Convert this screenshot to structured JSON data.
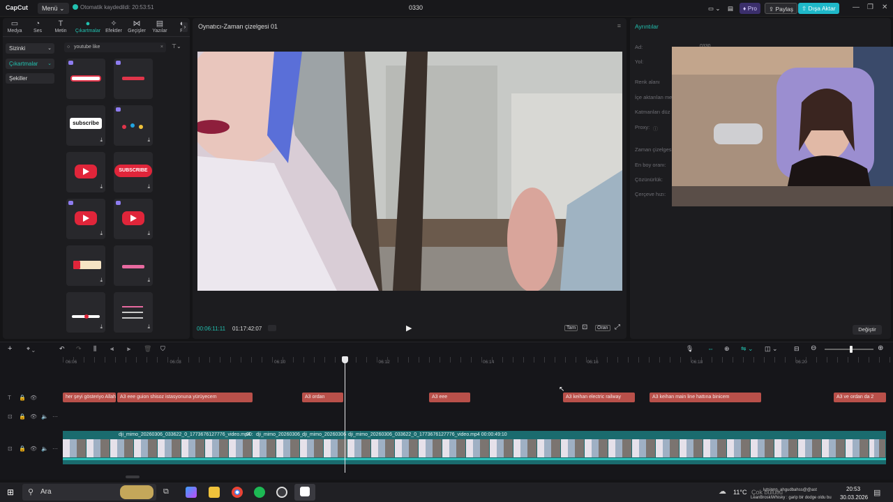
{
  "app": {
    "logo": "CapCut",
    "menu_label": "Menü",
    "autosave": "Otomatik kaydedildi: 20:53:51",
    "project_title": "0330",
    "pro_label": "Pro",
    "share_label": "Paylaş",
    "export_label": "Dışa Aktar"
  },
  "tool_tabs": [
    {
      "label": "Medya",
      "icon": "media-icon"
    },
    {
      "label": "Ses",
      "icon": "audio-icon"
    },
    {
      "label": "Metin",
      "icon": "text-icon"
    },
    {
      "label": "Çıkartmalar",
      "icon": "sticker-icon",
      "active": true
    },
    {
      "label": "Efektler",
      "icon": "effects-icon"
    },
    {
      "label": "Geçişler",
      "icon": "transitions-icon"
    },
    {
      "label": "Yazılar",
      "icon": "captions-icon"
    },
    {
      "label": "Fi",
      "icon": "filters-icon"
    }
  ],
  "sidebar": {
    "items": [
      {
        "label": "Sizinki"
      },
      {
        "label": "Çıkartmalar"
      },
      {
        "label": "Şekiller"
      }
    ]
  },
  "search": {
    "value": "youtube like"
  },
  "stickers": [
    {
      "kind": "like-pills"
    },
    {
      "kind": "red-bar"
    },
    {
      "kind": "subscribe-text"
    },
    {
      "kind": "colorful"
    },
    {
      "kind": "yt-red"
    },
    {
      "kind": "subscribe-red",
      "text": "SUBSCRIBE"
    },
    {
      "kind": "yt-red"
    },
    {
      "kind": "yt-red"
    },
    {
      "kind": "cream-bar"
    },
    {
      "kind": "pink-subscribe"
    },
    {
      "kind": "pink-bar"
    },
    {
      "kind": "list"
    }
  ],
  "player": {
    "title": "Oynatıcı-Zaman çizelgesi 01",
    "current_time": "00:06:11:11",
    "total_time": "01:17:42:07",
    "full_label": "Tam",
    "ratio_label": "Oran"
  },
  "details": {
    "title": "Ayrıntılar",
    "fields": [
      {
        "label": "Ad:",
        "value": "0330"
      },
      {
        "label": "Yol:",
        "value": ""
      },
      {
        "label": "Renk alanı",
        "value": ""
      },
      {
        "label": "İçe aktarılan me",
        "value": ""
      },
      {
        "label": "Katmanları düz",
        "value": ""
      },
      {
        "label": "Proxy:",
        "value": ""
      },
      {
        "label": "Zaman çizelges",
        "value": ""
      },
      {
        "label": "En boy oranı:",
        "value": ""
      },
      {
        "label": "Çözünürlük:",
        "value": ""
      },
      {
        "label": "Çerçeve hızı:",
        "value": ""
      }
    ],
    "change_label": "Değiştir"
  },
  "timeline": {
    "ruler": [
      "06:06",
      "06:08",
      "06:10",
      "06:12",
      "06:14",
      "06:16",
      "06:18",
      "06:20"
    ],
    "text_clips": [
      {
        "label": "her şeyi gösteriyo Allah"
      },
      {
        "label": "A3  eee guion shisoz istasyonuna yürüyecem"
      },
      {
        "label": "A3  ordan"
      },
      {
        "label": "A3  eee"
      },
      {
        "label": "A3  keihan electric railway"
      },
      {
        "label": "A3  keihan main line hattına binicem"
      },
      {
        "label": "A3  ve ordan da 2"
      }
    ],
    "video_clips": [
      {
        "label": "dji_mimo_20260306_033622_0_1773676127776_video.mp4"
      },
      {
        "label": "00:"
      },
      {
        "label": "dji_mimo_20260306_"
      },
      {
        "label": "dji_mimo_20260306"
      },
      {
        "label": "dji_mimo_20260306_033622_0_1773676127776_video.mp4    00:00:49:10"
      }
    ]
  },
  "taskbar": {
    "search": "Ara",
    "temp": "11°C",
    "weather": "Çok bulutlu",
    "notif1": "lutsinnn_ahgudbahss@@ast",
    "notif2": "LeanBroskiWhisky : garip bir dodge oldu bu",
    "time": "20:53",
    "date": "30.03.2026"
  },
  "colors": {
    "accent": "#22c1b0",
    "text_clip": "#b9504a",
    "video_track": "#1a6b6e"
  }
}
